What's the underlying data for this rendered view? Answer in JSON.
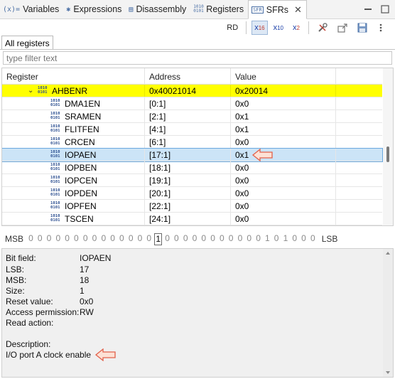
{
  "tabs": [
    {
      "icon": "(x)=",
      "label": "Variables"
    },
    {
      "icon": "✱",
      "label": "Expressions"
    },
    {
      "icon": "▤",
      "label": "Disassembly"
    },
    {
      "icon": "1010",
      "label": "Registers"
    },
    {
      "icon": "SFR",
      "label": "SFRs"
    }
  ],
  "toolbar": {
    "rd_label": "RD",
    "hex_label": "x",
    "hex_sub": "16",
    "dec_label": "x",
    "dec_sub": "10",
    "bin_label": "x",
    "bin_sub": "2"
  },
  "subtab": {
    "label": "All registers"
  },
  "filter": {
    "placeholder": "type filter text"
  },
  "table": {
    "headers": {
      "register": "Register",
      "address": "Address",
      "value": "Value"
    },
    "group": {
      "name": "AHBENR",
      "address": "0x40021014",
      "value": "0x20014"
    },
    "rows": [
      {
        "name": "DMA1EN",
        "address": "[0:1]",
        "value": "0x0"
      },
      {
        "name": "SRAMEN",
        "address": "[2:1]",
        "value": "0x1"
      },
      {
        "name": "FLITFEN",
        "address": "[4:1]",
        "value": "0x1"
      },
      {
        "name": "CRCEN",
        "address": "[6:1]",
        "value": "0x0"
      },
      {
        "name": "IOPAEN",
        "address": "[17:1]",
        "value": "0x1"
      },
      {
        "name": "IOPBEN",
        "address": "[18:1]",
        "value": "0x0"
      },
      {
        "name": "IOPCEN",
        "address": "[19:1]",
        "value": "0x0"
      },
      {
        "name": "IOPDEN",
        "address": "[20:1]",
        "value": "0x0"
      },
      {
        "name": "IOPFEN",
        "address": "[22:1]",
        "value": "0x0"
      },
      {
        "name": "TSCEN",
        "address": "[24:1]",
        "value": "0x0"
      }
    ]
  },
  "bitstrip": {
    "msb_label": "MSB",
    "lsb_label": "LSB",
    "bits": [
      "0",
      "0",
      "0",
      "0",
      "0",
      "0",
      "0",
      "0",
      "0",
      "0",
      "0",
      "0",
      "0",
      "0",
      "1",
      "0",
      "0",
      "0",
      "0",
      "0",
      "0",
      "0",
      "0",
      "0",
      "0",
      "0",
      "1",
      "0",
      "1",
      "0",
      "0",
      "0"
    ]
  },
  "info": {
    "bitfield_label": "Bit field:",
    "bitfield": "IOPAEN",
    "lsb_label": "LSB:",
    "lsb": "17",
    "msb_label": "MSB:",
    "msb": "18",
    "size_label": "Size:",
    "size": "1",
    "reset_label": "Reset value:",
    "reset": "0x0",
    "access_label": "Access permission:",
    "access": "RW",
    "read_action_label": "Read action:",
    "description_label": "Description:",
    "description": "I/O port A clock enable"
  },
  "colors": {
    "highlight": "#ffff00",
    "selection": "#cce4f7",
    "arrow_fill": "#fde1d5",
    "arrow_stroke": "#e2604a"
  }
}
